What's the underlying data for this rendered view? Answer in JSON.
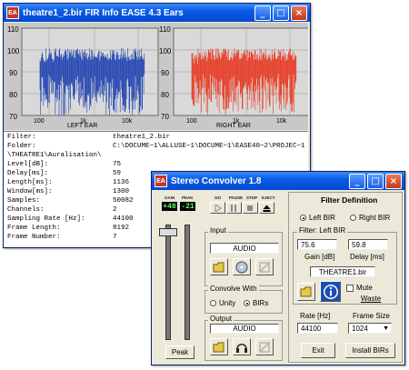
{
  "fir_window": {
    "title": "theatre1_2.bir FIR Info EASE 4.3 Ears",
    "left_ylabels": [
      "110",
      "100",
      "90",
      "80",
      "70"
    ],
    "left_xlabels": [
      "100",
      "1k",
      "10k"
    ],
    "left_caption": "LEFT EAR",
    "right_ylabels": [
      "110",
      "100",
      "90",
      "80",
      "70"
    ],
    "right_xlabels": [
      "100",
      "1k",
      "10k"
    ],
    "right_caption": "RIGHT EAR",
    "left_color": "#1a3fb0",
    "right_color": "#e8341c",
    "info": [
      {
        "k": "Filter:",
        "v": "theatre1_2.bir"
      },
      {
        "k": "Folder:",
        "v": "C:\\DOCUME~1\\ALLUSE~1\\DOCUME~1\\EASE40~2\\PROJEC~1"
      },
      {
        "k": "\\THEATRE1\\Auralisation\\",
        "v": ""
      },
      {
        "k": "Level[dB]:",
        "v": "75"
      },
      {
        "k": "Delay[ms]:",
        "v": "59"
      },
      {
        "k": "Length[ms]:",
        "v": "1136"
      },
      {
        "k": "Window[ms]:",
        "v": "1300"
      },
      {
        "k": "Samples:",
        "v": "50082"
      },
      {
        "k": "Channels:",
        "v": "2"
      },
      {
        "k": "Sampling Rate [Hz]:",
        "v": "44100"
      },
      {
        "k": "Frame Length:",
        "v": "8192"
      },
      {
        "k": "Frame Number:",
        "v": "7"
      }
    ]
  },
  "sc_window": {
    "title": "Stereo Convolver 1.8",
    "gain_label": "GAIN",
    "peak_label": "PEAK",
    "go_label": "GO",
    "pause_label": "PAUSE",
    "stop_label": "STOP",
    "eject_label": "EJECT",
    "gain_value": "+48",
    "peak_value": "-21",
    "input_label": "Input",
    "input_value": "AUDIO",
    "convolve_label": "Convolve With",
    "unity_label": "Unity",
    "birs_label": "BIRs",
    "output_label": "Output",
    "output_value": "AUDIO",
    "peak_button": "Peak",
    "filter_def_title": "Filter Definition",
    "left_bir_label": "Left BIR",
    "right_bir_label": "Right BIR",
    "filter_left_label": "Filter: Left BIR",
    "gain_field": "75.6",
    "delay_field": "59.8",
    "gain_db_label": "Gain [dB]",
    "delay_ms_label": "Delay [ms]",
    "bir_file": "THEATRE1.bir",
    "mute_label": "Mute",
    "waste_label": "Waste",
    "rate_label": "Rate [Hz]",
    "frame_size_label": "Frame Size",
    "rate_value": "44100",
    "frame_size_value": "1024",
    "exit_button": "Exit",
    "install_button": "Install BIRs"
  }
}
